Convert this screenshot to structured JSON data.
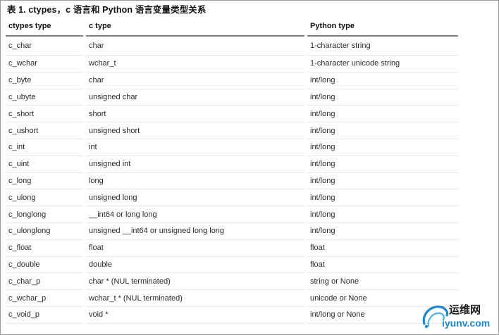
{
  "caption": "表 1. ctypes，c 语言和 Python 语言变量类型关系",
  "table": {
    "headers": [
      "ctypes type",
      "c type",
      "Python type"
    ],
    "rows": [
      [
        "c_char",
        "char",
        "1-character string"
      ],
      [
        "c_wchar",
        "wchar_t",
        "1-character unicode string"
      ],
      [
        "c_byte",
        "char",
        "int/long"
      ],
      [
        "c_ubyte",
        "unsigned char",
        "int/long"
      ],
      [
        "c_short",
        "short",
        "int/long"
      ],
      [
        "c_ushort",
        "unsigned short",
        "int/long"
      ],
      [
        "c_int",
        "int",
        "int/long"
      ],
      [
        "c_uint",
        "unsigned int",
        "int/long"
      ],
      [
        "c_long",
        "long",
        "int/long"
      ],
      [
        "c_ulong",
        "unsigned long",
        "int/long"
      ],
      [
        "c_longlong",
        "__int64 or long long",
        "int/long"
      ],
      [
        "c_ulonglong",
        "unsigned __int64 or unsigned long long",
        "int/long"
      ],
      [
        "c_float",
        "float",
        "float"
      ],
      [
        "c_double",
        "double",
        "float"
      ],
      [
        "c_char_p",
        "char * (NUL terminated)",
        "string or None"
      ],
      [
        "c_wchar_p",
        "wchar_t * (NUL terminated)",
        "unicode or None"
      ],
      [
        "c_void_p",
        "void *",
        "int/long or None"
      ]
    ]
  },
  "watermark": {
    "site_name": "运维网",
    "url": "iyunv.com",
    "accent_color": "#1e88c8"
  }
}
